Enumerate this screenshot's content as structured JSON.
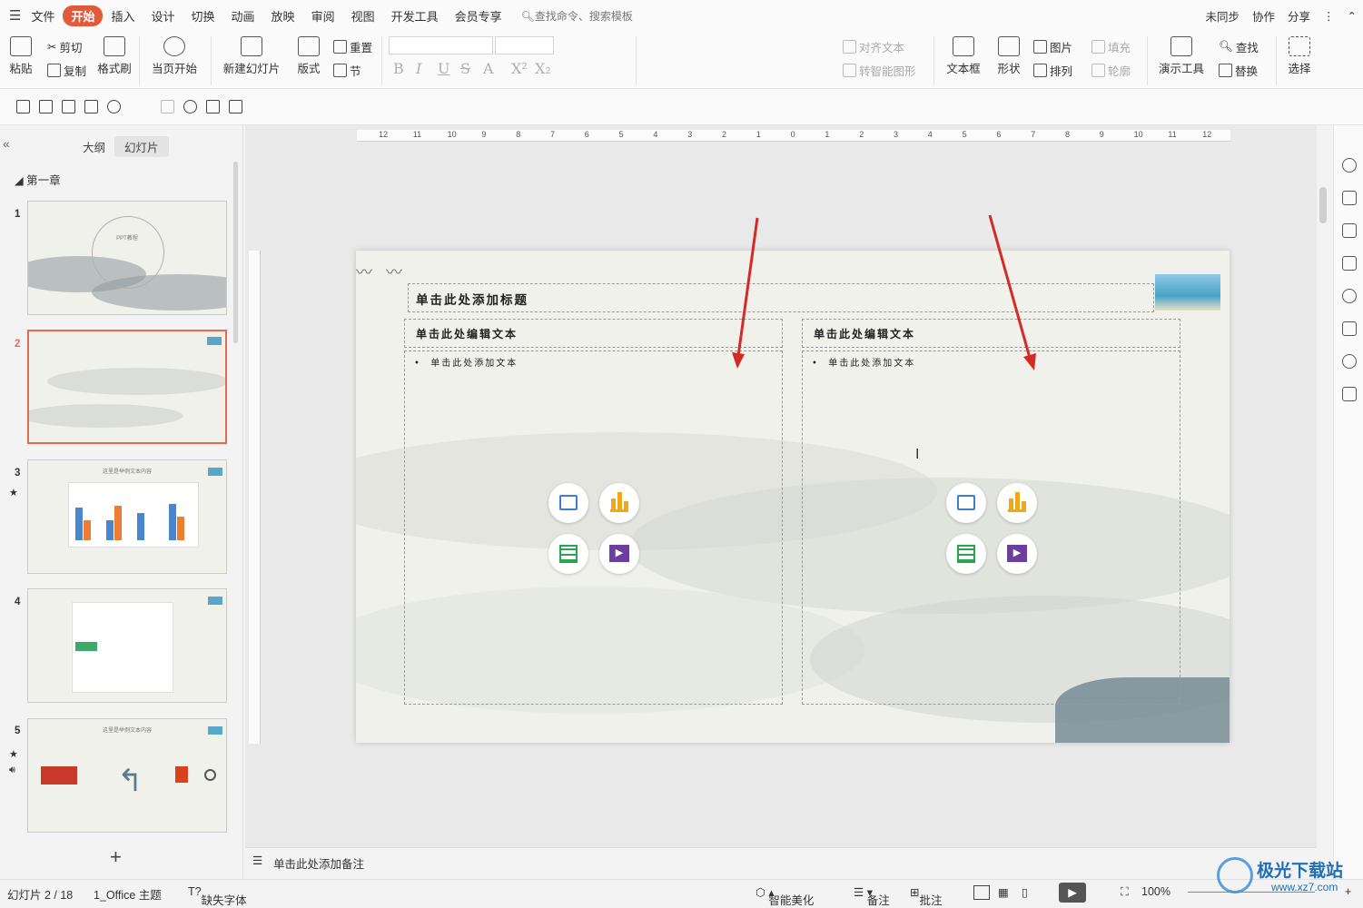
{
  "menu": {
    "file": "文件",
    "tabs": [
      "开始",
      "插入",
      "设计",
      "切换",
      "动画",
      "放映",
      "审阅",
      "视图",
      "开发工具",
      "会员专享"
    ],
    "search": "查找命令、搜索模板",
    "right": [
      "未同步",
      "协作",
      "分享"
    ]
  },
  "ribbon": {
    "paste": "粘贴",
    "cut": "剪切",
    "copy": "复制",
    "format_painter": "格式刷",
    "from_current": "当页开始",
    "new_slide": "新建幻灯片",
    "layout": "版式",
    "reset": "重置",
    "section": "节",
    "align_text": "对齐文本",
    "smart_art": "转智能图形",
    "textbox": "文本框",
    "shape": "形状",
    "picture": "图片",
    "arrange": "排列",
    "fill": "填充",
    "outline": "轮廓",
    "present_tools": "演示工具",
    "find": "查找",
    "replace": "替换",
    "select": "选择"
  },
  "panel": {
    "tab_outline": "大纲",
    "tab_slides": "幻灯片",
    "chapter": "第一章",
    "slides": [
      {
        "num": "1",
        "title": "PPT教程"
      },
      {
        "num": "2",
        "title": ""
      },
      {
        "num": "3",
        "title": "这里是举例文本内容"
      },
      {
        "num": "4",
        "title": ""
      },
      {
        "num": "5",
        "title": "这里是举例文本内容"
      }
    ]
  },
  "ruler": {
    "h_ticks": [
      "12",
      "11",
      "10",
      "9",
      "8",
      "7",
      "6",
      "5",
      "4",
      "3",
      "2",
      "1",
      "0",
      "1",
      "2",
      "3",
      "4",
      "5",
      "6",
      "7",
      "8",
      "9",
      "10",
      "11",
      "12"
    ]
  },
  "slide": {
    "title_placeholder": "单击此处添加标题",
    "left_heading": "单击此处编辑文本",
    "right_heading": "单击此处编辑文本",
    "left_bullet": "单击此处添加文本",
    "right_bullet": "单击此处添加文本"
  },
  "notes": {
    "placeholder": "单击此处添加备注"
  },
  "status": {
    "slide_count": "幻灯片 2 / 18",
    "theme": "1_Office 主题",
    "missing_font": "缺失字体",
    "beautify": "智能美化",
    "notes": "备注",
    "comment": "批注",
    "zoom": "100%"
  },
  "watermark": {
    "site": "极光下载站",
    "url": "www.xz7.com"
  },
  "colors": {
    "accent": "#e15a3a",
    "selection": "#e56b4f",
    "arrow": "#d42b26",
    "icon_image": "#3b7dd8",
    "icon_chart": "#f0a818",
    "icon_table": "#27a54f",
    "icon_video": "#6b3ea0"
  }
}
